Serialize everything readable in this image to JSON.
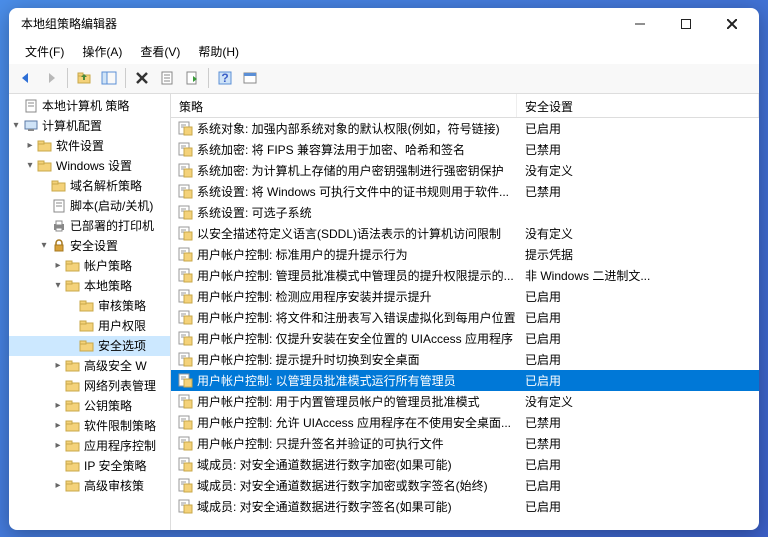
{
  "window": {
    "title": "本地组策略编辑器"
  },
  "menu": {
    "file": "文件(F)",
    "action": "操作(A)",
    "view": "查看(V)",
    "help": "帮助(H)"
  },
  "tree": {
    "root": "本地计算机 策略",
    "computerConfig": "计算机配置",
    "softwareSettings": "软件设置",
    "windowsSettings": "Windows 设置",
    "nameResPolicy": "域名解析策略",
    "scripts": "脚本(启动/关机)",
    "deployedPrinters": "已部署的打印机",
    "securitySettings": "安全设置",
    "accountPolicies": "帐户策略",
    "localPolicies": "本地策略",
    "auditPolicy": "审核策略",
    "userRights": "用户权限",
    "securityOptions": "安全选项",
    "advancedW": "高级安全 W",
    "networkList": "网络列表管理",
    "publicKey": "公钥策略",
    "softwareRestrict": "软件限制策略",
    "appControl": "应用程序控制",
    "ipSecurity": "IP 安全策略",
    "advancedAudit": "高级审核策"
  },
  "columns": {
    "policy": "策略",
    "setting": "安全设置"
  },
  "rows": [
    {
      "p": "系统对象: 加强内部系统对象的默认权限(例如，符号链接)",
      "s": "已启用"
    },
    {
      "p": "系统加密: 将 FIPS 兼容算法用于加密、哈希和签名",
      "s": "已禁用"
    },
    {
      "p": "系统加密: 为计算机上存储的用户密钥强制进行强密钥保护",
      "s": "没有定义"
    },
    {
      "p": "系统设置: 将 Windows 可执行文件中的证书规则用于软件...",
      "s": "已禁用"
    },
    {
      "p": "系统设置: 可选子系统",
      "s": ""
    },
    {
      "p": "以安全描述符定义语言(SDDL)语法表示的计算机访问限制",
      "s": "没有定义"
    },
    {
      "p": "用户帐户控制: 标准用户的提升提示行为",
      "s": "提示凭据"
    },
    {
      "p": "用户帐户控制: 管理员批准模式中管理员的提升权限提示的...",
      "s": "非 Windows 二进制文..."
    },
    {
      "p": "用户帐户控制: 检测应用程序安装并提示提升",
      "s": "已启用"
    },
    {
      "p": "用户帐户控制: 将文件和注册表写入错误虚拟化到每用户位置",
      "s": "已启用"
    },
    {
      "p": "用户帐户控制: 仅提升安装在安全位置的 UIAccess 应用程序",
      "s": "已启用"
    },
    {
      "p": "用户帐户控制: 提示提升时切换到安全桌面",
      "s": "已启用"
    },
    {
      "p": "用户帐户控制: 以管理员批准模式运行所有管理员",
      "s": "已启用",
      "sel": true
    },
    {
      "p": "用户帐户控制: 用于内置管理员帐户的管理员批准模式",
      "s": "没有定义"
    },
    {
      "p": "用户帐户控制: 允许 UIAccess 应用程序在不使用安全桌面...",
      "s": "已禁用"
    },
    {
      "p": "用户帐户控制: 只提升签名并验证的可执行文件",
      "s": "已禁用"
    },
    {
      "p": "域成员: 对安全通道数据进行数字加密(如果可能)",
      "s": "已启用"
    },
    {
      "p": "域成员: 对安全通道数据进行数字加密或数字签名(始终)",
      "s": "已启用"
    },
    {
      "p": "域成员: 对安全通道数据进行数字签名(如果可能)",
      "s": "已启用"
    }
  ]
}
